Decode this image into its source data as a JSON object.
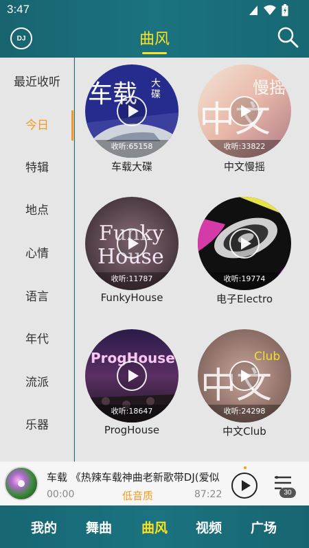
{
  "status_bar": {
    "time": "3:47"
  },
  "header": {
    "logo_text": "DJ",
    "title": "曲风"
  },
  "sidebar": {
    "items": [
      {
        "label": "最近收听"
      },
      {
        "label": "今日"
      },
      {
        "label": "特辑"
      },
      {
        "label": "地点"
      },
      {
        "label": "心情"
      },
      {
        "label": "语言"
      },
      {
        "label": "年代"
      },
      {
        "label": "流派"
      },
      {
        "label": "乐器"
      }
    ],
    "active_index": 1
  },
  "genres": [
    {
      "title": "车载大碟",
      "listen": "收听:65158",
      "art_text_1": "车载",
      "art_text_2": "大碟"
    },
    {
      "title": "中文慢摇",
      "listen": "收听:33822",
      "art_text_1": "中文",
      "art_text_2": "慢摇"
    },
    {
      "title": "FunkyHouse",
      "listen": "收听:11787",
      "art_text_1": "Funky",
      "art_text_2": "House"
    },
    {
      "title": "电子Electro",
      "listen": "收听:19774"
    },
    {
      "title": "ProgHouse",
      "listen": "收听:18647",
      "art_text_1": "ProgHouse"
    },
    {
      "title": "中文Club",
      "listen": "收听:24298",
      "art_text_1": "中文",
      "art_text_2": "Club"
    }
  ],
  "player": {
    "title": "车载 《热辣车载神曲老新歌带DJ(爱似",
    "time_current": "00:00",
    "quality": "低音质",
    "time_total": "87:22",
    "playlist_count": "30"
  },
  "bottom_nav": {
    "items": [
      {
        "label": "我的"
      },
      {
        "label": "舞曲"
      },
      {
        "label": "曲风"
      },
      {
        "label": "视频"
      },
      {
        "label": "广场"
      }
    ],
    "active_index": 2
  },
  "colors": {
    "accent": "#ffe21b",
    "highlight": "#f39a1e",
    "bar": "#1b7380",
    "panel": "#e6e6e6"
  }
}
